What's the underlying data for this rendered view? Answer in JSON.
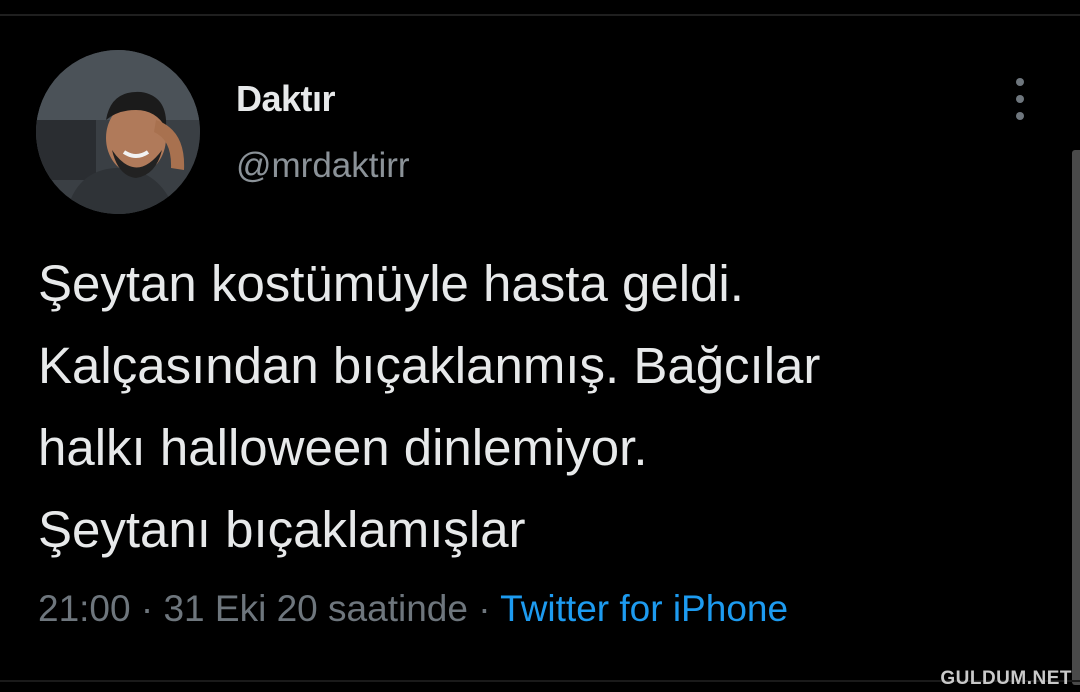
{
  "user": {
    "display_name": "Daktır",
    "handle": "@mrdaktirr"
  },
  "icons": {
    "avatar": "profile-photo",
    "more": "more-options-icon"
  },
  "tweet": {
    "lines": [
      "Şeytan kostümüyle hasta geldi.",
      "Kalçasından bıçaklanmış. Bağcılar",
      "halkı halloween dinlemiyor.",
      "Şeytanı bıçaklamışlar"
    ]
  },
  "meta": {
    "time": "21:00",
    "separator": " · ",
    "date": "31 Eki 20 saatinde",
    "source": "Twitter for iPhone"
  },
  "watermark": "GULDUM.NET",
  "colors": {
    "background": "#000000",
    "text": "#e7e9ea",
    "secondary_text": "#6e767d",
    "link": "#1d9bf0"
  }
}
